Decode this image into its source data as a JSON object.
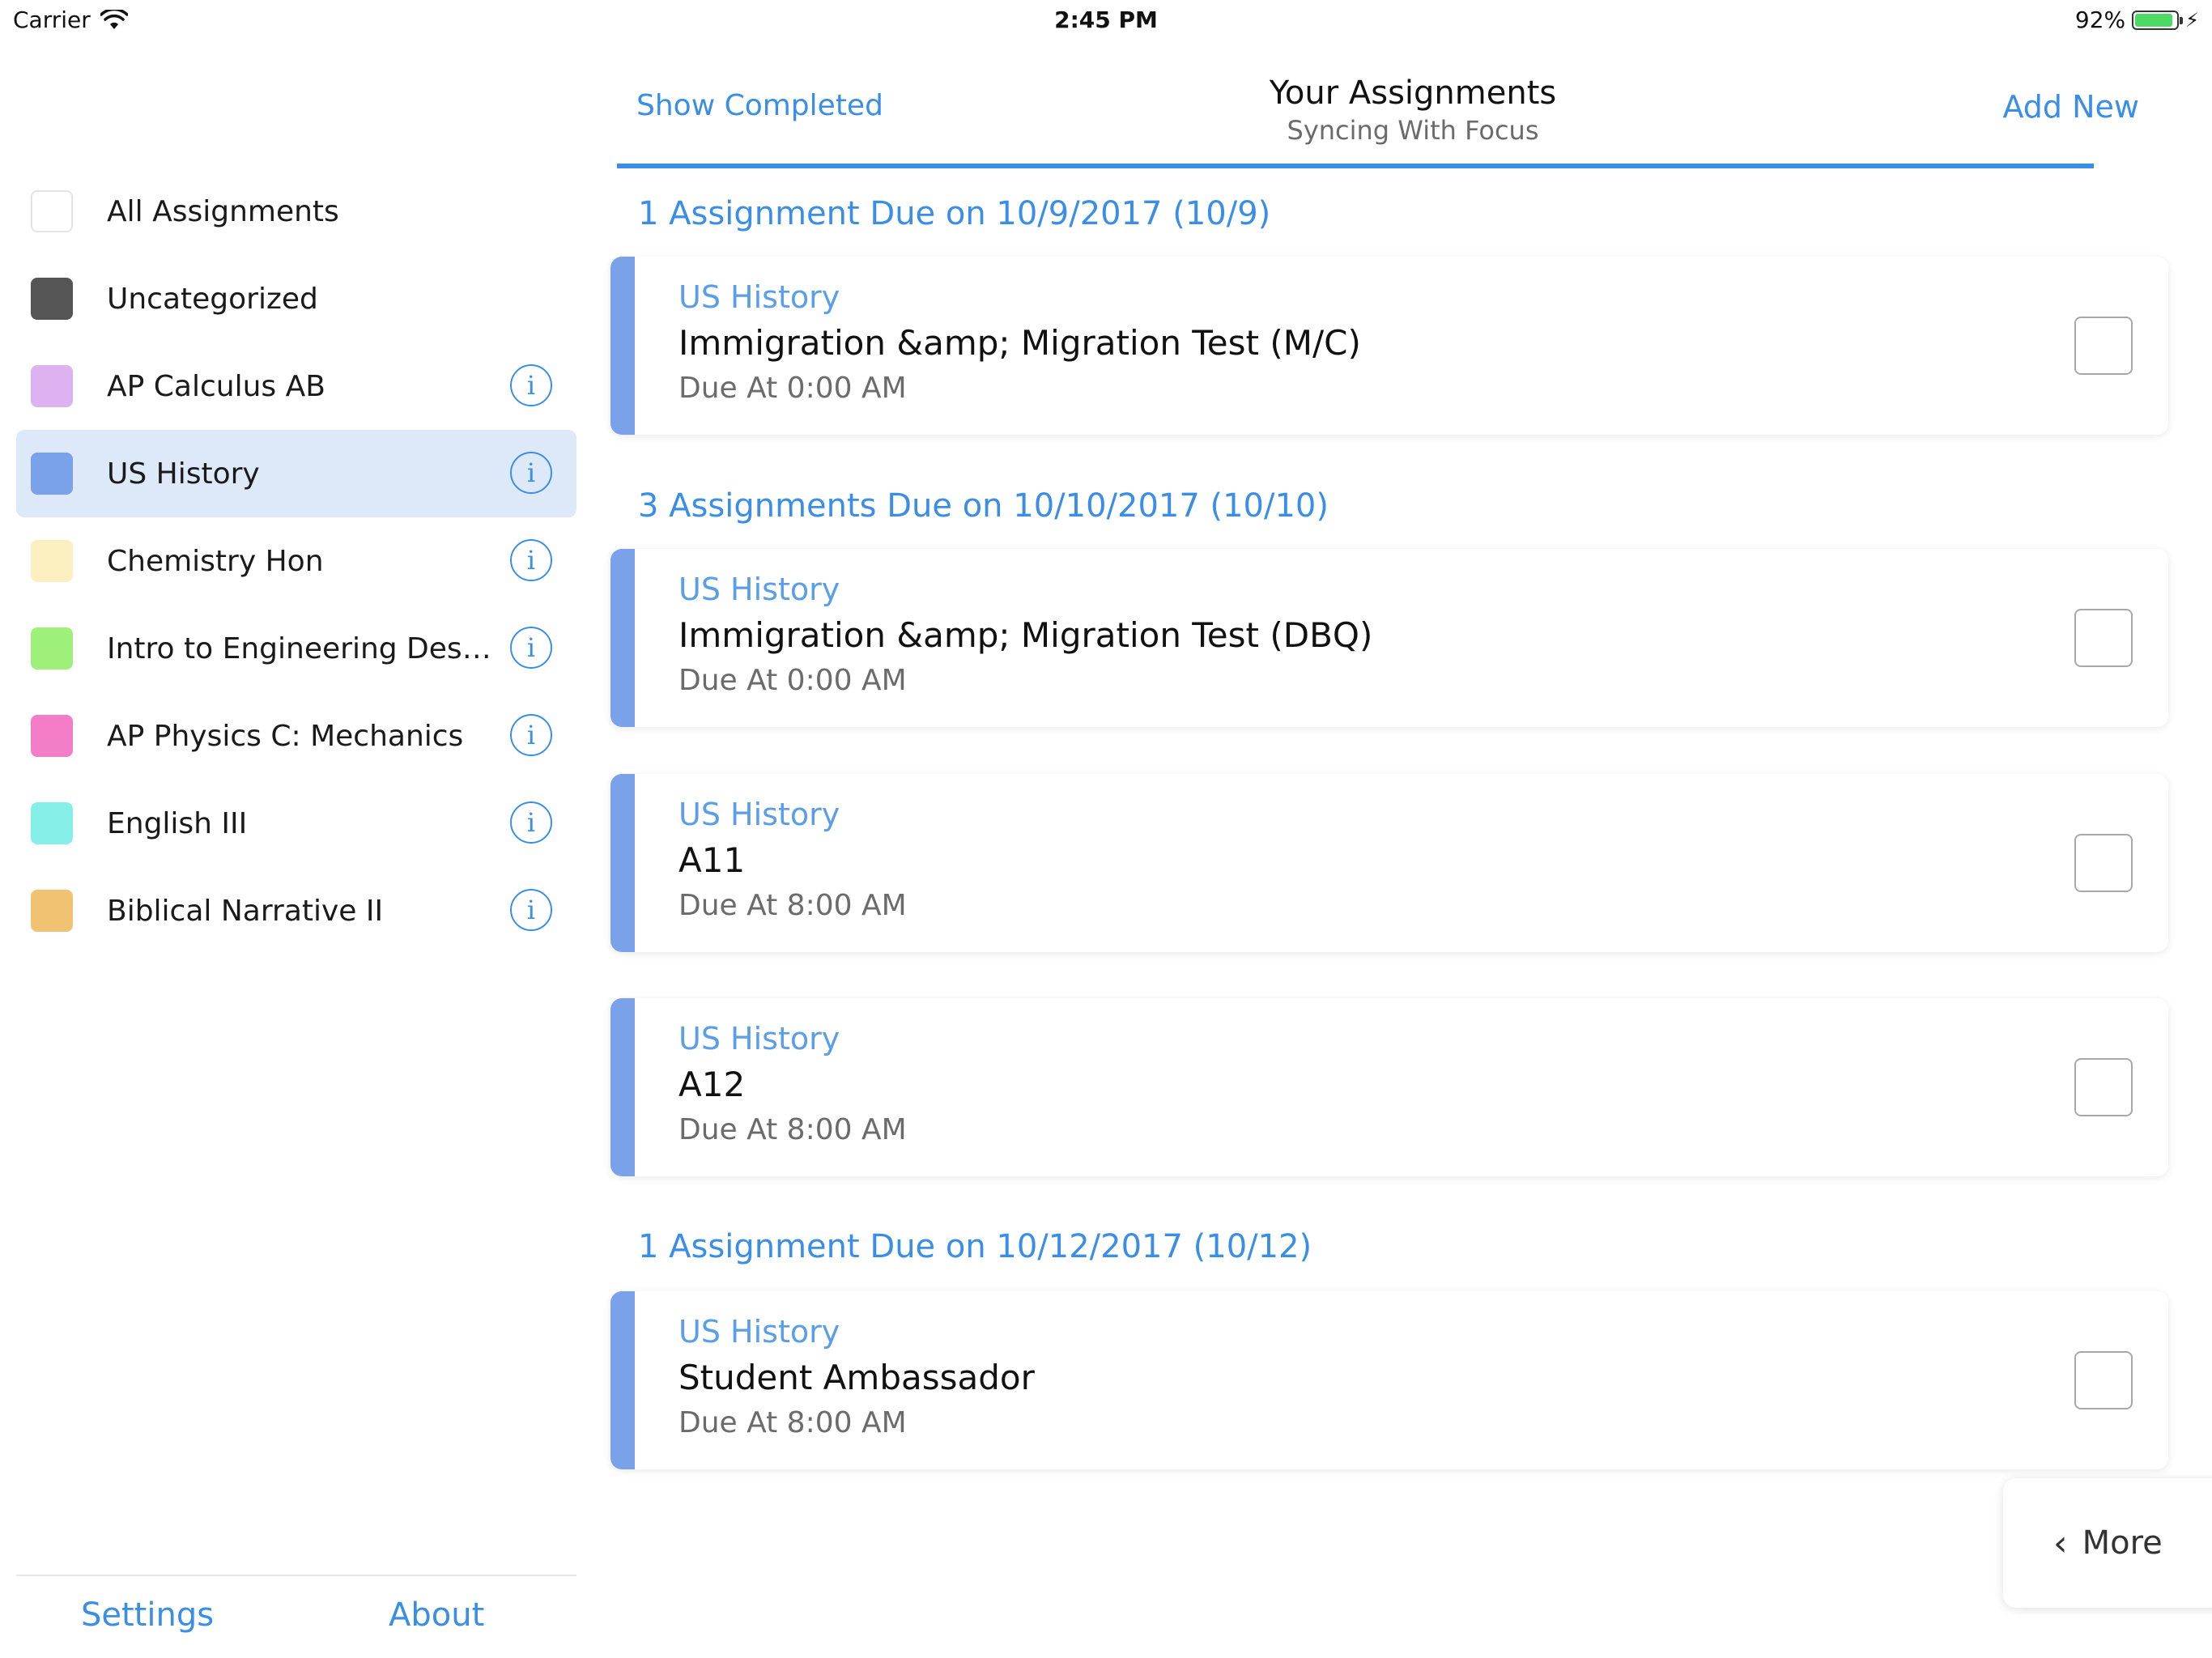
{
  "status_bar": {
    "carrier": "Carrier",
    "time": "2:45 PM",
    "battery_text": "92%",
    "battery_level": 0.92
  },
  "sidebar": {
    "categories": [
      {
        "label": "All Assignments",
        "color": "#ffffff",
        "has_info": false,
        "selected": false
      },
      {
        "label": "Uncategorized",
        "color": "#555555",
        "has_info": false,
        "selected": false
      },
      {
        "label": "AP Calculus AB",
        "color": "#dcb3f0",
        "has_info": true,
        "selected": false
      },
      {
        "label": "US History",
        "color": "#7aa2ea",
        "has_info": true,
        "selected": true
      },
      {
        "label": "Chemistry Hon",
        "color": "#fdf0c0",
        "has_info": true,
        "selected": false
      },
      {
        "label": "Intro to Engineering Design...",
        "color": "#9ef07a",
        "has_info": true,
        "selected": false
      },
      {
        "label": "AP Physics C: Mechanics",
        "color": "#f47dc7",
        "has_info": true,
        "selected": false
      },
      {
        "label": "English III",
        "color": "#86f0e8",
        "has_info": true,
        "selected": false
      },
      {
        "label": "Biblical Narrative II",
        "color": "#f0c272",
        "has_info": true,
        "selected": false
      }
    ],
    "info_glyph": "i",
    "settings_label": "Settings",
    "about_label": "About"
  },
  "header": {
    "left_label": "Show Completed",
    "title": "Your Assignments",
    "subtitle": "Syncing With Focus",
    "right_label": "Add New"
  },
  "groups": [
    {
      "header": "1 Assignment Due on 10/9/2017 (10/9)",
      "assignments": [
        {
          "course": "US History",
          "title": "Immigration &amp; Migration Test (M/C)",
          "due": "Due At 0:00 AM"
        }
      ]
    },
    {
      "header": "3 Assignments Due on 10/10/2017 (10/10)",
      "assignments": [
        {
          "course": "US History",
          "title": "Immigration &amp; Migration Test (DBQ)",
          "due": "Due At 0:00 AM"
        },
        {
          "course": "US History",
          "title": "A11",
          "due": "Due At 8:00 AM"
        },
        {
          "course": "US History",
          "title": "A12",
          "due": "Due At 8:00 AM"
        }
      ]
    },
    {
      "header": "1 Assignment Due on 10/12/2017 (10/12)",
      "assignments": [
        {
          "course": "US History",
          "title": "Student Ambassador",
          "due": "Due At 8:00 AM"
        }
      ]
    }
  ],
  "accent_color": "#3a8ee6",
  "course_bar_color": "#7aa2ea",
  "more_button": {
    "chevron": "‹",
    "label": "More"
  }
}
